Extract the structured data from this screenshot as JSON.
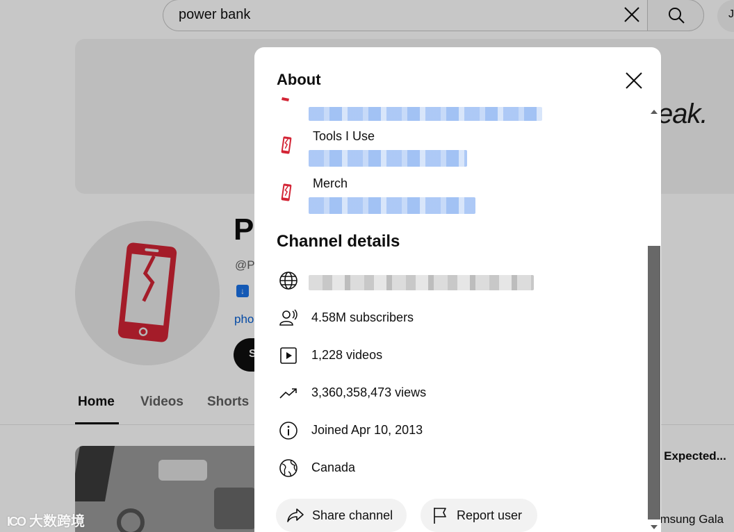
{
  "search": {
    "query": "power bank"
  },
  "channel": {
    "banner_text": "eak.",
    "name_partial": "P",
    "handle_partial": "@P",
    "link_partial": "pho",
    "subscribe_partial": "S",
    "badge_icon": "download-icon"
  },
  "tabs": [
    {
      "label": "Home",
      "active": true
    },
    {
      "label": "Videos",
      "active": false
    },
    {
      "label": "Shorts",
      "active": false
    }
  ],
  "videos": [
    {
      "title": "n Expected..."
    },
    {
      "title": "amsung Gala"
    }
  ],
  "watermark": {
    "logo": "ICO",
    "text": "大数跨境"
  },
  "about": {
    "title": "About",
    "close_icon": "close-icon",
    "links": [
      {
        "title": "",
        "icon": "phone-logo-icon"
      },
      {
        "title": "Tools I Use",
        "icon": "phone-logo-icon"
      },
      {
        "title": "Merch",
        "icon": "phone-logo-icon"
      }
    ],
    "details_title": "Channel details",
    "details": [
      {
        "icon": "globe-icon",
        "text": ""
      },
      {
        "icon": "subscribers-icon",
        "text": "4.58M subscribers"
      },
      {
        "icon": "video-play-icon",
        "text": "1,228 videos"
      },
      {
        "icon": "trending-icon",
        "text": "3,360,358,473 views"
      },
      {
        "icon": "info-icon",
        "text": "Joined Apr 10, 2013"
      },
      {
        "icon": "globe-location-icon",
        "text": "Canada"
      }
    ],
    "actions": [
      {
        "label": "Share channel",
        "icon": "share-icon"
      },
      {
        "label": "Report user",
        "icon": "flag-icon"
      }
    ]
  },
  "colors": {
    "brand_red": "#d32435",
    "link_blue": "#065fd4",
    "overlay": "rgba(0,0,0,0.22)"
  }
}
